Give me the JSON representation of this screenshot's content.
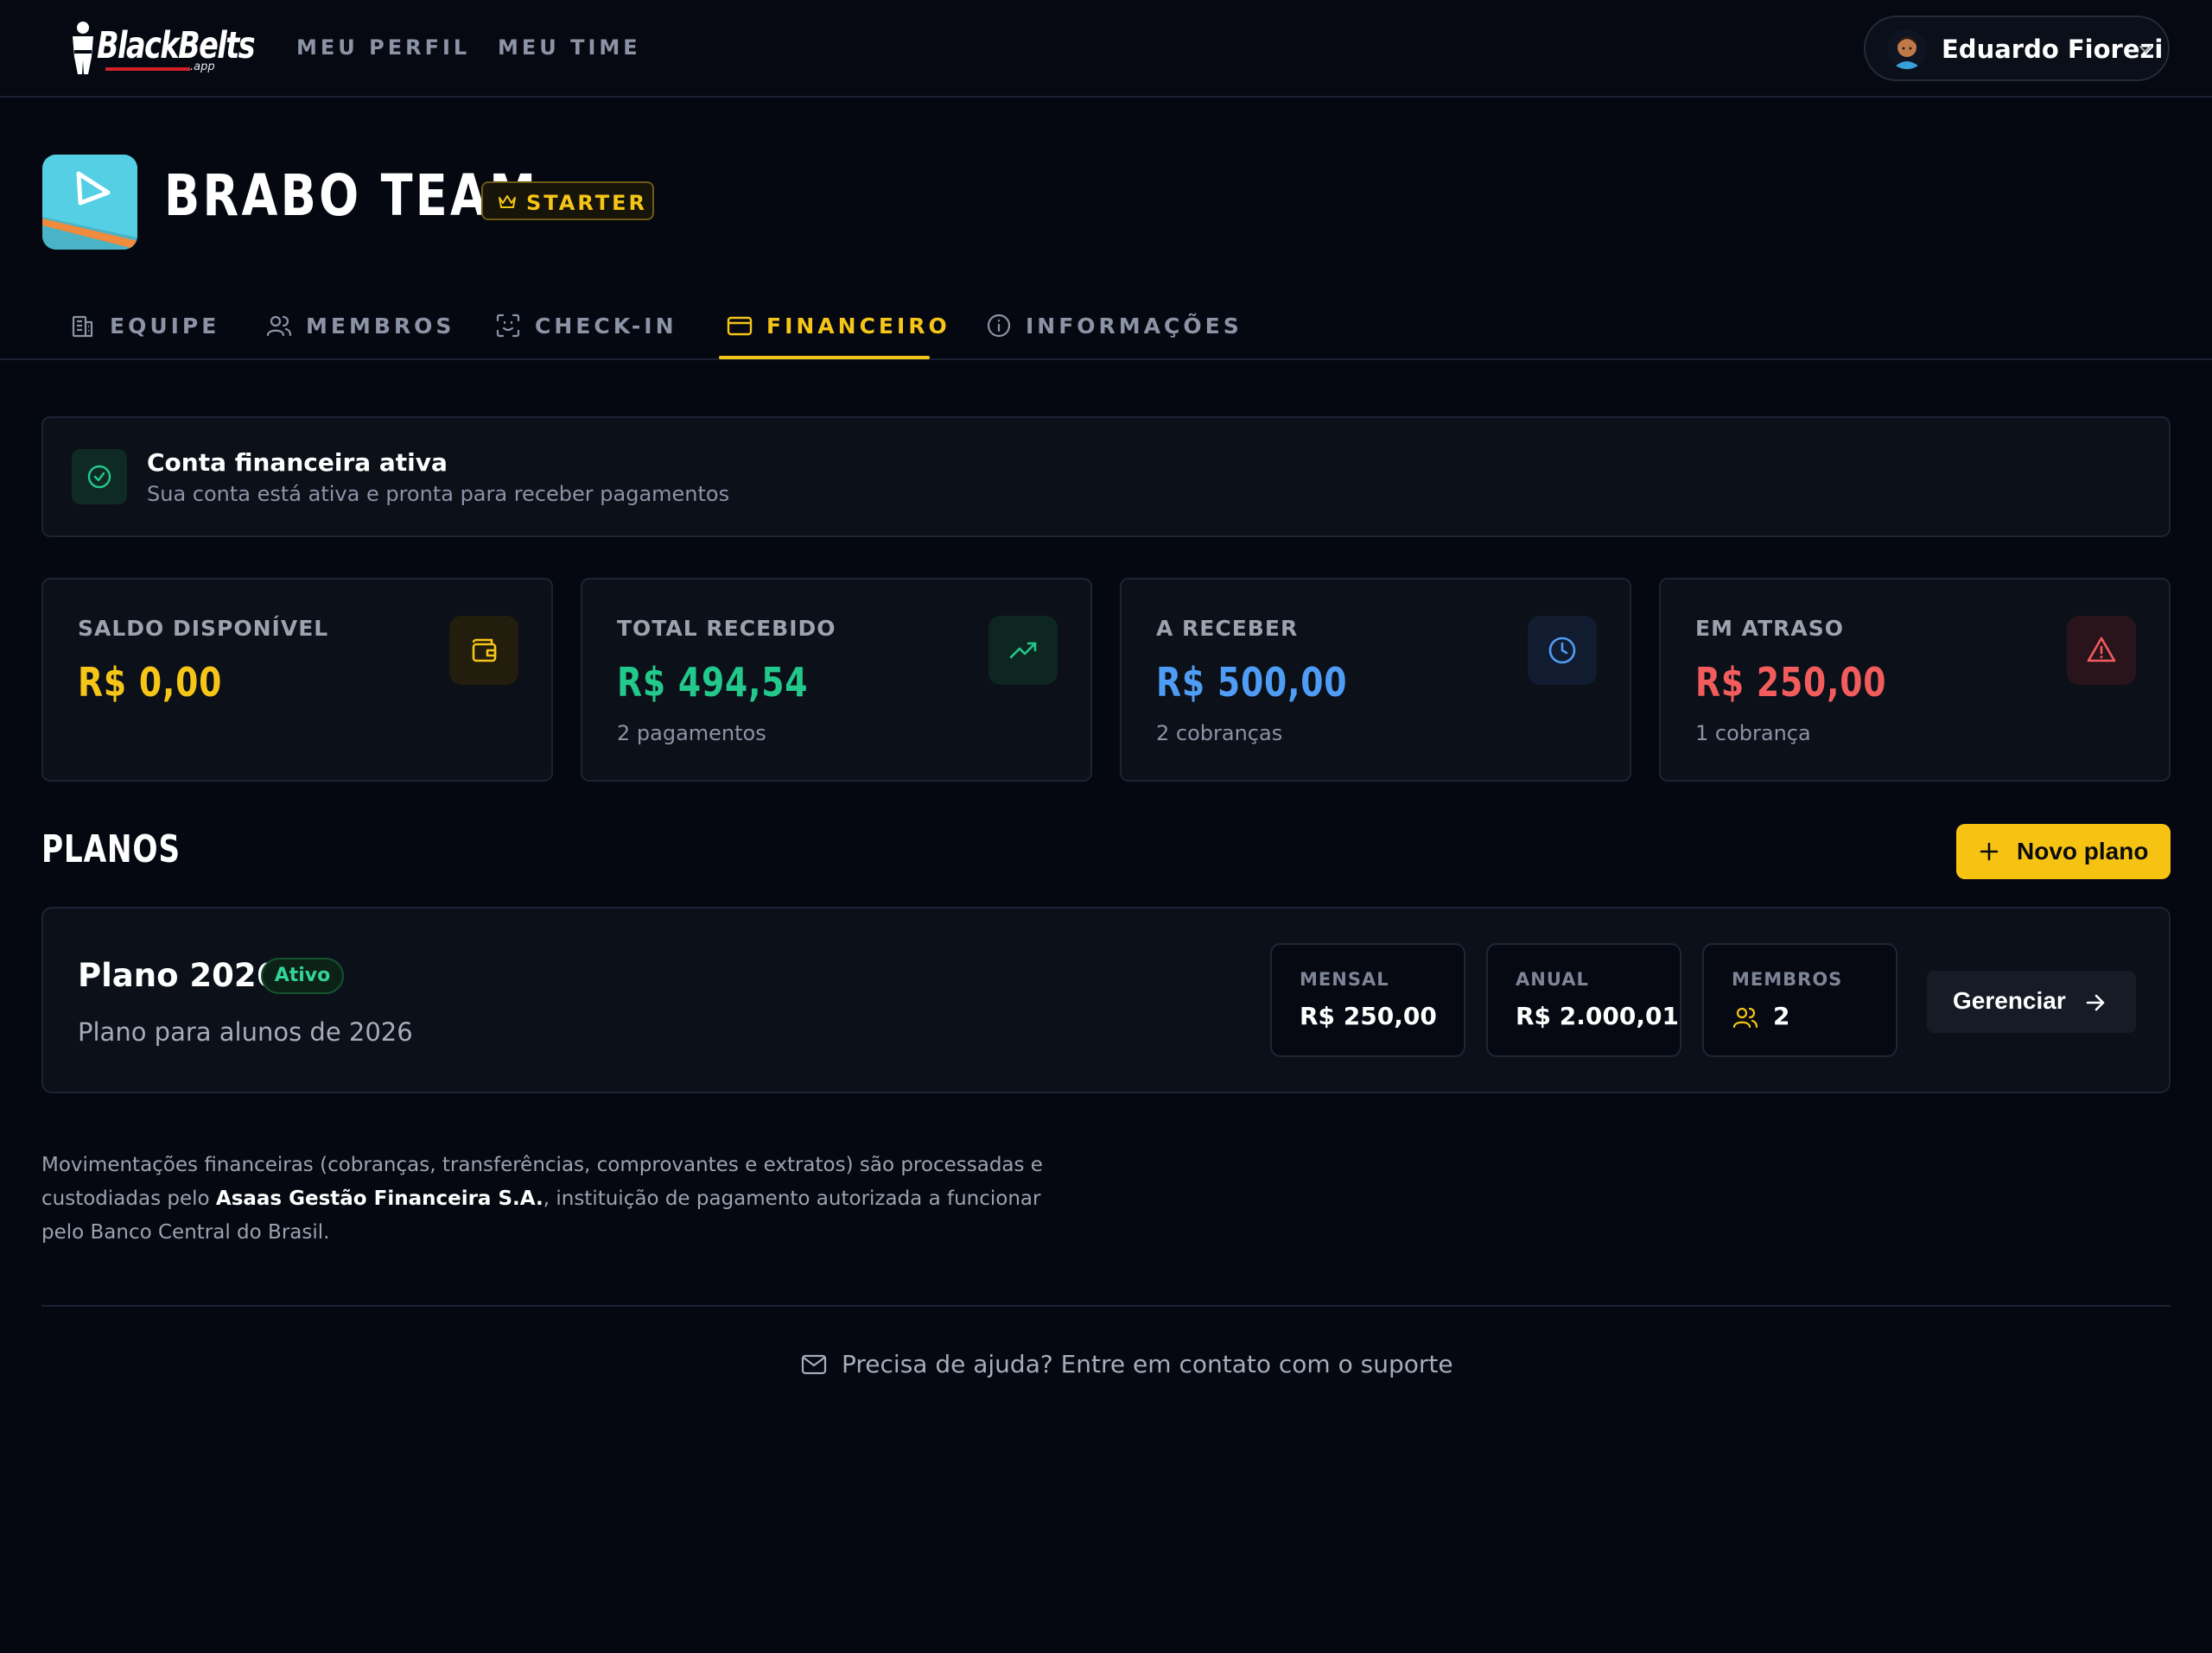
{
  "brand": {
    "name": "BlackBelts",
    "sub": ".app"
  },
  "nav": {
    "profile": "MEU PERFIL",
    "team": "MEU TIME"
  },
  "user": {
    "name": "Eduardo Fiorezi"
  },
  "team": {
    "title": "BRABO TEAM",
    "plan_badge": "STARTER"
  },
  "tabs": [
    {
      "label": "EQUIPE",
      "icon": "building-icon"
    },
    {
      "label": "MEMBROS",
      "icon": "users-icon"
    },
    {
      "label": "CHECK-IN",
      "icon": "face-scan-icon"
    },
    {
      "label": "FINANCEIRO",
      "icon": "credit-card-icon",
      "active": true
    },
    {
      "label": "INFORMAÇÕES",
      "icon": "info-icon"
    }
  ],
  "account_status": {
    "title": "Conta financeira ativa",
    "subtitle": "Sua conta está ativa e pronta para receber pagamentos"
  },
  "stats": [
    {
      "label": "SALDO DISPONÍVEL",
      "value": "R$ 0,00",
      "sub": "",
      "color": "#f5c518",
      "icon": "wallet-icon"
    },
    {
      "label": "TOTAL RECEBIDO",
      "value": "R$ 494,54",
      "sub": "2 pagamentos",
      "color": "#22c98a",
      "icon": "trending-up-icon"
    },
    {
      "label": "A RECEBER",
      "value": "R$ 500,00",
      "sub": "2 cobranças",
      "color": "#4f9cf5",
      "icon": "clock-icon"
    },
    {
      "label": "EM ATRASO",
      "value": "R$ 250,00",
      "sub": "1 cobrança",
      "color": "#f25c5c",
      "icon": "alert-triangle-icon"
    }
  ],
  "plans": {
    "title": "PLANOS",
    "new_button": "Novo plano",
    "items": [
      {
        "name": "Plano 2026",
        "status": "Ativo",
        "description": "Plano para alunos de 2026",
        "monthly_label": "MENSAL",
        "monthly_value": "R$ 250,00",
        "annual_label": "ANUAL",
        "annual_value": "R$ 2.000,01",
        "members_label": "MEMBROS",
        "members_value": "2",
        "manage_button": "Gerenciar"
      }
    ]
  },
  "disclaimer": {
    "part1": "Movimentações financeiras (cobranças, transferências, comprovantes e extratos) são processadas e custodiadas pelo ",
    "company": "Asaas Gestão Financeira S.A.",
    "part2": ", instituição de pagamento autorizada a funcionar pelo Banco Central do Brasil."
  },
  "support": {
    "label": "Precisa de ajuda? Entre em contato com o suporte"
  }
}
